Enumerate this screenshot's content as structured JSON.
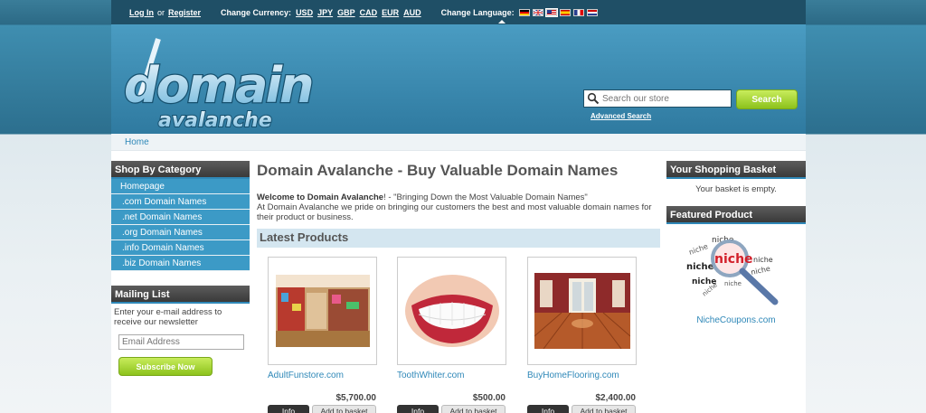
{
  "topbar": {
    "login": "Log In",
    "or": "or",
    "register": "Register",
    "currency_label": "Change Currency:",
    "currencies": [
      "USD",
      "JPY",
      "GBP",
      "CAD",
      "EUR",
      "AUD"
    ],
    "language_label": "Change Language:",
    "language_flags": [
      "german-flag-icon",
      "uk-flag-icon",
      "us-flag-icon",
      "spanish-flag-icon",
      "french-flag-icon",
      "dutch-flag-icon"
    ]
  },
  "header": {
    "logo_word1": "domain",
    "logo_word2": "avalanche",
    "search_placeholder": "Search our store",
    "search_button": "Search",
    "advanced_search": "Advanced Search"
  },
  "breadcrumb": "Home",
  "categories": {
    "title": "Shop By Category",
    "items": [
      "Homepage",
      ".com Domain Names",
      ".net Domain Names",
      ".org Domain Names",
      ".info Domain Names",
      ".biz Domain Names"
    ]
  },
  "mailing": {
    "title": "Mailing List",
    "text": "Enter your e-mail address to receive our newsletter",
    "placeholder": "Email Address",
    "button": "Subscribe Now"
  },
  "main": {
    "title": "Domain Avalanche - Buy Valuable Domain Names",
    "welcome_bold": "Welcome to Domain Avalanche",
    "welcome_rest": "! - \"Bringing Down the Most Valuable Domain Names\"",
    "welcome_line2": "At Domain Avalanche we pride on bringing our customers the best and most valuable domain names for their product or business.",
    "latest_title": "Latest Products"
  },
  "products": [
    {
      "name": "AdultFunstore.com",
      "price": "$5,700.00",
      "info": "Info",
      "basket": "Add to basket"
    },
    {
      "name": "ToothWhiter.com",
      "price": "$500.00",
      "info": "Info",
      "basket": "Add to basket"
    },
    {
      "name": "BuyHomeFlooring.com",
      "price": "$2,400.00",
      "info": "Info",
      "basket": "Add to basket"
    }
  ],
  "basket": {
    "title": "Your Shopping Basket",
    "empty": "Your basket is empty."
  },
  "featured": {
    "title": "Featured Product",
    "name": "NicheCoupons.com",
    "image_word": "niche"
  },
  "colors": {
    "accent": "#2f88b8",
    "green_button": "#8cc21c",
    "dark_header": "#3a3a3a"
  }
}
